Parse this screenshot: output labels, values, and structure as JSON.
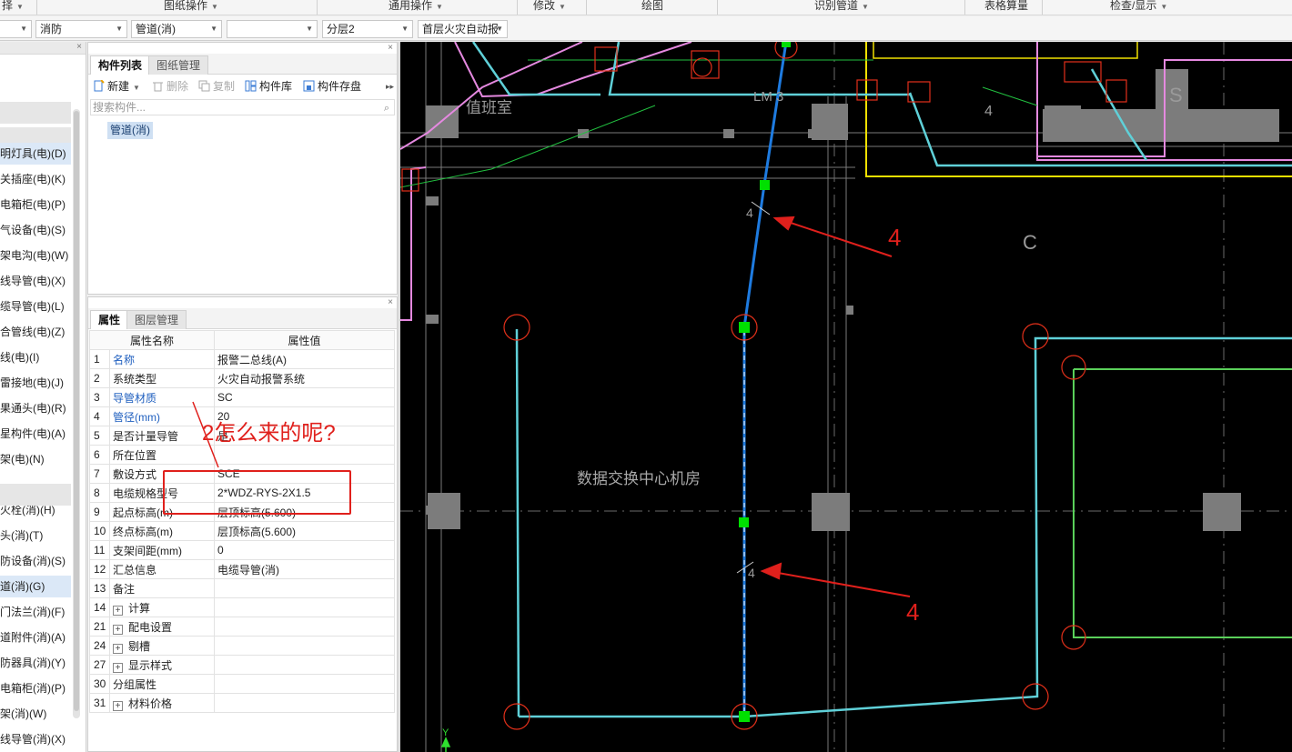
{
  "menubar": {
    "items": [
      {
        "label": "择",
        "has_arrow": true
      },
      {
        "label": "图纸操作",
        "has_arrow": true
      },
      {
        "label": "通用操作",
        "has_arrow": true
      },
      {
        "label": "修改",
        "has_arrow": true
      },
      {
        "label": "绘图",
        "has_arrow": false
      },
      {
        "label": "识别管道",
        "has_arrow": true
      },
      {
        "label": "表格算量",
        "has_arrow": false
      },
      {
        "label": "检查/显示",
        "has_arrow": true
      }
    ]
  },
  "filterbar": {
    "combo0": "",
    "discipline": "消防",
    "type": "管道(消)",
    "sub": "",
    "floor": "分层2",
    "drawing": "首层火灾自动报"
  },
  "tree": {
    "items": [
      {
        "label": "明灯具(电)(D)",
        "selected": true
      },
      {
        "label": "关插座(电)(K)"
      },
      {
        "label": "电箱柜(电)(P)"
      },
      {
        "label": "气设备(电)(S)"
      },
      {
        "label": "架电沟(电)(W)"
      },
      {
        "label": "线导管(电)(X)"
      },
      {
        "label": "缆导管(电)(L)"
      },
      {
        "label": "合管线(电)(Z)"
      },
      {
        "label": "线(电)(I)"
      },
      {
        "label": "雷接地(电)(J)"
      },
      {
        "label": "果通头(电)(R)"
      },
      {
        "label": "星构件(电)(A)"
      },
      {
        "label": "架(电)(N)"
      },
      {
        "label": "火栓(消)(H)"
      },
      {
        "label": "头(消)(T)"
      },
      {
        "label": "防设备(消)(S)"
      },
      {
        "label": "道(消)(G)",
        "selected": true
      },
      {
        "label": "门法兰(消)(F)"
      },
      {
        "label": "道附件(消)(A)"
      },
      {
        "label": "防器具(消)(Y)"
      },
      {
        "label": "电箱柜(消)(P)"
      },
      {
        "label": "架(消)(W)"
      },
      {
        "label": "线导管(消)(X)"
      }
    ]
  },
  "component_panel": {
    "tab_list": "构件列表",
    "tab_drawing": "图纸管理",
    "btn_new": "新建",
    "btn_delete": "删除",
    "btn_copy": "复制",
    "btn_library": "构件库",
    "btn_save": "构件存盘",
    "search_placeholder": "搜索构件...",
    "selected_component": "管道(消)"
  },
  "property_panel": {
    "tab_props": "属性",
    "tab_layers": "图层管理",
    "col_name": "属性名称",
    "col_value": "属性值",
    "rows": [
      {
        "n": "1",
        "k": "名称",
        "v": "报警二总线(A)",
        "blue": true
      },
      {
        "n": "2",
        "k": "系统类型",
        "v": "火灾自动报警系统"
      },
      {
        "n": "3",
        "k": "导管材质",
        "v": "SC",
        "blue": true
      },
      {
        "n": "4",
        "k": "管径(mm)",
        "v": "20",
        "blue": true
      },
      {
        "n": "5",
        "k": "是否计量导管",
        "v": "是"
      },
      {
        "n": "6",
        "k": "所在位置",
        "v": ""
      },
      {
        "n": "7",
        "k": "敷设方式",
        "v": "SCE"
      },
      {
        "n": "8",
        "k": "电缆规格型号",
        "v": "2*WDZ-RYS-2X1.5"
      },
      {
        "n": "9",
        "k": "起点标高(m)",
        "v": "层顶标高(5.600)"
      },
      {
        "n": "10",
        "k": "终点标高(m)",
        "v": "层顶标高(5.600)"
      },
      {
        "n": "11",
        "k": "支架间距(mm)",
        "v": "0"
      },
      {
        "n": "12",
        "k": "汇总信息",
        "v": "电缆导管(消)"
      },
      {
        "n": "13",
        "k": "备注",
        "v": ""
      },
      {
        "n": "14",
        "k": "计算",
        "v": "",
        "expand": true
      },
      {
        "n": "21",
        "k": "配电设置",
        "v": "",
        "expand": true
      },
      {
        "n": "24",
        "k": "剔槽",
        "v": "",
        "expand": true
      },
      {
        "n": "27",
        "k": "显示样式",
        "v": "",
        "expand": true
      },
      {
        "n": "30",
        "k": "分组属性",
        "v": ""
      },
      {
        "n": "31",
        "k": "材料价格",
        "v": "",
        "expand": true
      }
    ]
  },
  "annotation": {
    "question": "2怎么来的呢?",
    "mark_top": "4",
    "mark_bottom": "4"
  },
  "canvas": {
    "room_name": "数据交换中心机房",
    "duty_room": "值班室",
    "axis_c": "C",
    "axis_s": "S",
    "lm3": "LM 3",
    "line_label_1": "4",
    "line_label_2": "4",
    "line_label_3": "4",
    "ucs_y": "Y"
  },
  "colors": {
    "accent_blue": "#1f5fbf",
    "annotation_red": "#e0201c",
    "pipe_cyan": "#5fd0d8",
    "pipe_blue": "#1e7be0",
    "node_green": "#00e000",
    "wall_pink": "#e589e0",
    "wall_yellow": "#f0e000"
  }
}
